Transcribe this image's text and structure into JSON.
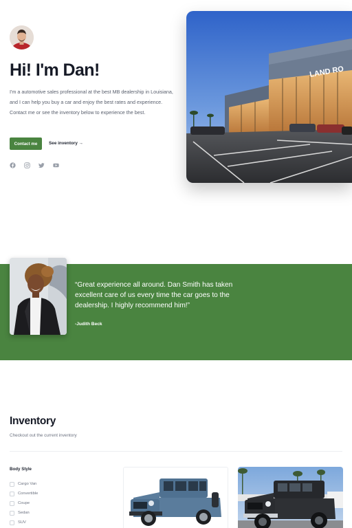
{
  "hero": {
    "greeting": "Hi! I'm Dan!",
    "description": "I'm a automotive sales professional at the best MB dealership in Louisiana, and I can help you buy a car and enjoy the best rates and experience. Contact me or see the inventory below to experience the best.",
    "contact_label": "Contact me",
    "inventory_link_label": "See inventory →",
    "social_icons": [
      "facebook-icon",
      "instagram-icon",
      "twitter-icon",
      "youtube-icon"
    ],
    "photo_sign_text": "LAND RO"
  },
  "testimonial": {
    "quote": "“Great experience all around. Dan Smith has taken excellent care of us every time the car goes to the dealership. I highly recommend him!”",
    "author": "-Judith Beck"
  },
  "inventory": {
    "title": "Inventory",
    "subtitle": "Checkout out the current inventory",
    "filter_title": "Body Style",
    "body_styles": [
      "Cargo Van",
      "Convertible",
      "Coupe",
      "Sedan",
      "SUV"
    ]
  },
  "colors": {
    "accent": "#4a8440",
    "heading": "#161a26",
    "muted_text": "#6c7280"
  }
}
